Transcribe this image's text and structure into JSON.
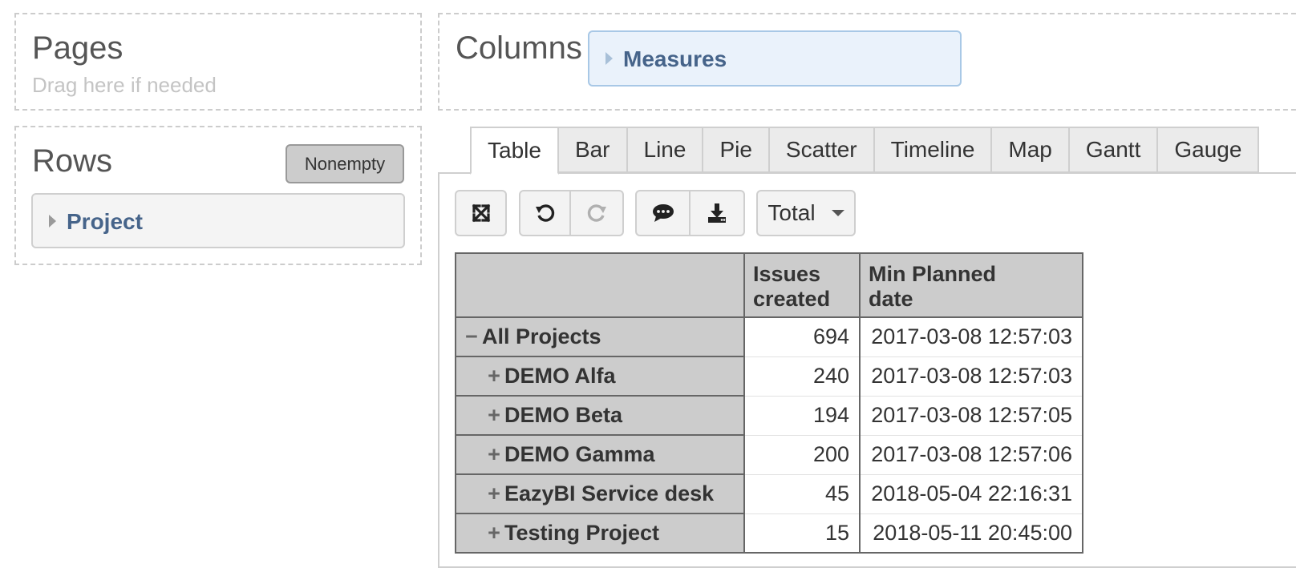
{
  "pages_panel": {
    "title": "Pages",
    "hint": "Drag here if needed"
  },
  "columns_panel": {
    "title": "Columns",
    "dimension": "Measures"
  },
  "rows_panel": {
    "title": "Rows",
    "nonempty_label": "Nonempty",
    "dimension": "Project"
  },
  "tabs": [
    "Table",
    "Bar",
    "Line",
    "Pie",
    "Scatter",
    "Timeline",
    "Map",
    "Gantt",
    "Gauge"
  ],
  "active_tab": "Table",
  "toolbar": {
    "icons": [
      "fullscreen-icon",
      "undo-icon",
      "redo-icon",
      "comment-icon",
      "download-icon"
    ],
    "total_label": "Total"
  },
  "table": {
    "headers": [
      "",
      "Issues created",
      "Min Planned date"
    ],
    "header_lines": [
      [
        "Issues",
        "created"
      ],
      [
        "Min Planned",
        "date"
      ]
    ],
    "rows": [
      {
        "sign": "−",
        "label": "All Projects",
        "issues": "694",
        "date": "2017-03-08 12:57:03"
      },
      {
        "sign": "+",
        "label": "DEMO Alfa",
        "issues": "240",
        "date": "2017-03-08 12:57:03"
      },
      {
        "sign": "+",
        "label": "DEMO Beta",
        "issues": "194",
        "date": "2017-03-08 12:57:05"
      },
      {
        "sign": "+",
        "label": "DEMO Gamma",
        "issues": "200",
        "date": "2017-03-08 12:57:06"
      },
      {
        "sign": "+",
        "label": "EazyBI Service desk",
        "issues": "45",
        "date": "2018-05-04 22:16:31"
      },
      {
        "sign": "+",
        "label": "Testing Project",
        "issues": "15",
        "date": "2018-05-11 20:45:00"
      }
    ]
  },
  "colors": {
    "dimension_text": "#46648a",
    "measures_bg": "#eaf2fb",
    "header_bg": "#cccccc"
  }
}
